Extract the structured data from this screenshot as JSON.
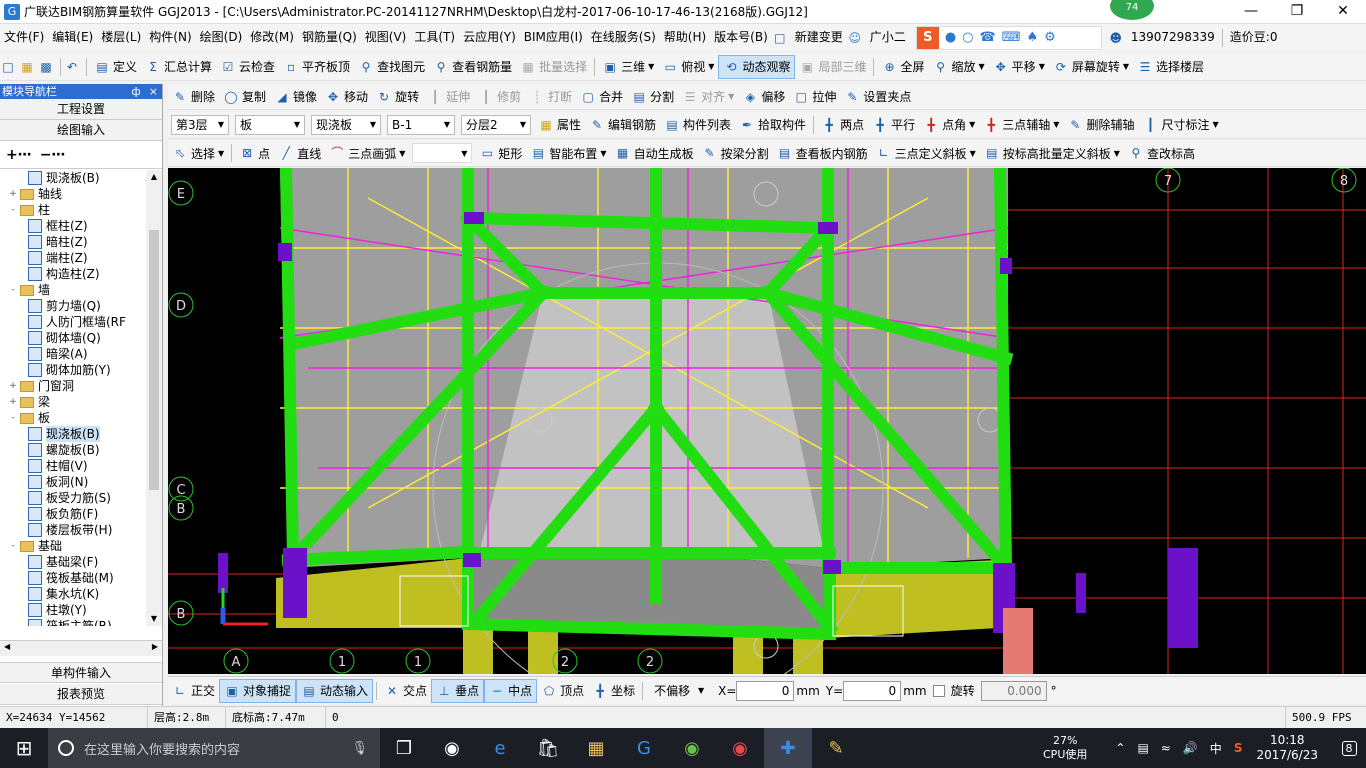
{
  "window": {
    "title": "广联达BIM钢筋算量软件 GGJ2013 - [C:\\Users\\Administrator.PC-20141127NRHM\\Desktop\\白龙村-2017-06-10-17-46-13(2168版).GGJ12]",
    "badge": "74"
  },
  "menu": [
    "文件(F)",
    "编辑(E)",
    "楼层(L)",
    "构件(N)",
    "绘图(D)",
    "修改(M)",
    "钢筋量(Q)",
    "视图(V)",
    "工具(T)",
    "云应用(Y)",
    "BIM应用(I)",
    "在线服务(S)",
    "帮助(H)",
    "版本号(B)"
  ],
  "menu_right": {
    "new_change": "新建变更",
    "assistant": "广小二",
    "phone": "13907298339",
    "coins": "造价豆:0"
  },
  "toolbar1": [
    "定义",
    "汇总计算",
    "云检查",
    "平齐板顶",
    "查找图元",
    "查看钢筋量",
    "批量选择",
    "三维",
    "俯视",
    "动态观察",
    "局部三维",
    "全屏",
    "缩放",
    "平移",
    "屏幕旋转",
    "选择楼层"
  ],
  "toolbar2": [
    "删除",
    "复制",
    "镜像",
    "移动",
    "旋转",
    "延伸",
    "修剪",
    "打断",
    "合并",
    "分割",
    "对齐",
    "偏移",
    "拉伸",
    "设置夹点"
  ],
  "toolbar3": {
    "floor": "第3层",
    "type": "板",
    "subtype": "现浇板",
    "name": "B-1",
    "layer": "分层2",
    "buttons": [
      "属性",
      "编辑钢筋",
      "构件列表",
      "拾取构件",
      "两点",
      "平行",
      "点角",
      "三点辅轴",
      "删除辅轴",
      "尺寸标注"
    ]
  },
  "toolbar4": [
    "选择",
    "点",
    "直线",
    "三点画弧",
    "矩形",
    "智能布置",
    "自动生成板",
    "按梁分割",
    "查看板内钢筋",
    "三点定义斜板",
    "按标高批量定义斜板",
    "查改标高"
  ],
  "nav": {
    "title": "模块导航栏",
    "pin": "ф",
    "close": "×",
    "btn_project": "工程设置",
    "btn_drawing": "绘图输入",
    "tree": [
      {
        "label": "现浇板(B)",
        "level": 2,
        "kind": "item"
      },
      {
        "label": "轴线",
        "level": 1,
        "kind": "folder",
        "toggle": "+"
      },
      {
        "label": "柱",
        "level": 1,
        "kind": "folder",
        "toggle": "-"
      },
      {
        "label": "框柱(Z)",
        "level": 2,
        "kind": "item"
      },
      {
        "label": "暗柱(Z)",
        "level": 2,
        "kind": "item"
      },
      {
        "label": "端柱(Z)",
        "level": 2,
        "kind": "item"
      },
      {
        "label": "构造柱(Z)",
        "level": 2,
        "kind": "item"
      },
      {
        "label": "墙",
        "level": 1,
        "kind": "folder",
        "toggle": "-"
      },
      {
        "label": "剪力墙(Q)",
        "level": 2,
        "kind": "item"
      },
      {
        "label": "人防门框墙(RF",
        "level": 2,
        "kind": "item"
      },
      {
        "label": "砌体墙(Q)",
        "level": 2,
        "kind": "item"
      },
      {
        "label": "暗梁(A)",
        "level": 2,
        "kind": "item"
      },
      {
        "label": "砌体加筋(Y)",
        "level": 2,
        "kind": "item"
      },
      {
        "label": "门窗洞",
        "level": 1,
        "kind": "folder",
        "toggle": "+"
      },
      {
        "label": "梁",
        "level": 1,
        "kind": "folder",
        "toggle": "+"
      },
      {
        "label": "板",
        "level": 1,
        "kind": "folder",
        "toggle": "-"
      },
      {
        "label": "现浇板(B)",
        "level": 2,
        "kind": "item",
        "selected": true
      },
      {
        "label": "螺旋板(B)",
        "level": 2,
        "kind": "item"
      },
      {
        "label": "柱帽(V)",
        "level": 2,
        "kind": "item"
      },
      {
        "label": "板洞(N)",
        "level": 2,
        "kind": "item"
      },
      {
        "label": "板受力筋(S)",
        "level": 2,
        "kind": "item"
      },
      {
        "label": "板负筋(F)",
        "level": 2,
        "kind": "item"
      },
      {
        "label": "楼层板带(H)",
        "level": 2,
        "kind": "item"
      },
      {
        "label": "基础",
        "level": 1,
        "kind": "folder",
        "toggle": "-"
      },
      {
        "label": "基础梁(F)",
        "level": 2,
        "kind": "item"
      },
      {
        "label": "筏板基础(M)",
        "level": 2,
        "kind": "item"
      },
      {
        "label": "集水坑(K)",
        "level": 2,
        "kind": "item"
      },
      {
        "label": "柱墩(Y)",
        "level": 2,
        "kind": "item"
      },
      {
        "label": "筏板主筋(R)",
        "level": 2,
        "kind": "item"
      }
    ],
    "btn_single": "单构件输入",
    "btn_report": "报表预览"
  },
  "canvas": {
    "axis_labels": [
      "E",
      "D",
      "C",
      "B",
      "B",
      "A",
      "1",
      "1",
      "2",
      "2",
      "7",
      "8"
    ],
    "colors": {
      "slab": "#aaaaaa",
      "beam": "#22dd11",
      "rebar_yellow": "#ffee33",
      "rebar_magenta": "#ee22dd",
      "grid_red": "#dd2222",
      "column": "#6a11c9",
      "wall": "#bfbf22"
    }
  },
  "bottom": {
    "buttons": [
      "正交",
      "对象捕捉",
      "动态输入",
      "交点",
      "垂点",
      "中点",
      "顶点",
      "坐标"
    ],
    "offset_mode": "不偏移",
    "x_label": "X=",
    "x_value": "0",
    "x_unit": "mm",
    "y_label": "Y=",
    "y_value": "0",
    "y_unit": "mm",
    "rotate_label": "旋转",
    "rotate_value": "0.000",
    "rotate_unit": "°"
  },
  "status": {
    "coords": "X=24634 Y=14562",
    "floor_height": "层高:2.8m",
    "base_height": "底标高:7.47m",
    "extra": "0",
    "fps": "500.9 FPS"
  },
  "taskbar": {
    "search_placeholder": "在这里输入你要搜索的内容",
    "cpu_percent": "27%",
    "cpu_label": "CPU使用",
    "ime": "中",
    "time": "10:18",
    "date": "2017/6/23",
    "notif_count": "8"
  }
}
